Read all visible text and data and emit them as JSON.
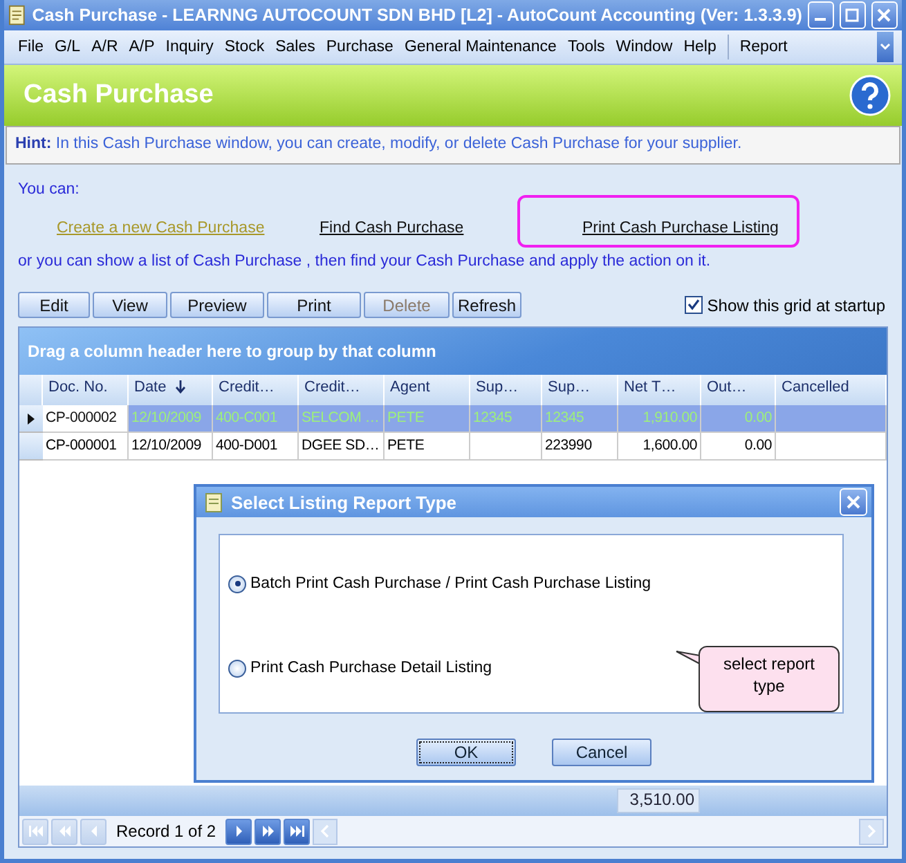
{
  "window": {
    "title": "Cash Purchase - LEARNNG AUTOCOUNT SDN BHD [L2] - AutoCount Accounting (Ver: 1.3.3.9)"
  },
  "menu": [
    "File",
    "G/L",
    "A/R",
    "A/P",
    "Inquiry",
    "Stock",
    "Sales",
    "Purchase",
    "General Maintenance",
    "Tools",
    "Window",
    "Help",
    "Report"
  ],
  "header": {
    "title": "Cash Purchase"
  },
  "hint": "**Hint:** In this Cash Purchase window, you can create, modify, or delete Cash Purchase for your supplier.",
  "intro": "You can:",
  "links": [
    {
      "label": "Create a new Cash Purchase",
      "visited": true
    },
    {
      "label": "Find Cash Purchase",
      "visited": false
    },
    {
      "label": "Print Cash Purchase Listing",
      "visited": false
    }
  ],
  "or_text": "or you can show a  list of Cash Purchase , then find your Cash Purchase and apply the action on it.",
  "toolbar": [
    {
      "label": "Edit",
      "disabled": false
    },
    {
      "label": "View",
      "disabled": false
    },
    {
      "label": "Preview",
      "disabled": false
    },
    {
      "label": "Print",
      "disabled": false
    },
    {
      "label": "Delete",
      "disabled": true
    },
    {
      "label": "Refresh",
      "disabled": false
    }
  ],
  "show_grid": {
    "label": "Show this grid at startup",
    "checked": true
  },
  "grid": {
    "group_hint": "Drag a column header here to group by that column",
    "columns": [
      {
        "label": "Doc. No.",
        "kind": "text"
      },
      {
        "label": "Date",
        "kind": "text",
        "sorted": true
      },
      {
        "label": "Credit…",
        "kind": "text"
      },
      {
        "label": "Credit…",
        "kind": "text"
      },
      {
        "label": "Agent",
        "kind": "text"
      },
      {
        "label": "Sup…",
        "kind": "text"
      },
      {
        "label": "Sup…",
        "kind": "text"
      },
      {
        "label": "Net T…",
        "kind": "number"
      },
      {
        "label": "Out…",
        "kind": "number"
      },
      {
        "label": "Cancelled",
        "kind": "text"
      }
    ],
    "rows": [
      {
        "selected": true,
        "cells": [
          "CP-000002",
          "12/10/2009",
          "400-C001",
          "SELCOM …",
          "PETE",
          "12345",
          "12345",
          "1,910.00",
          "0.00",
          ""
        ]
      },
      {
        "selected": false,
        "cells": [
          "CP-000001",
          "12/10/2009",
          "400-D001",
          "DGEE SD…",
          "PETE",
          "",
          "223990",
          "1,600.00",
          "0.00",
          ""
        ]
      }
    ],
    "total": "3,510.00",
    "record": "Record 1 of 2",
    "nav": [
      {
        "kind": "first",
        "disabled": true
      },
      {
        "kind": "prev_page",
        "disabled": true
      },
      {
        "kind": "prev",
        "disabled": true
      },
      {
        "kind": "next",
        "disabled": false
      },
      {
        "kind": "next_page",
        "disabled": false
      },
      {
        "kind": "last",
        "disabled": false
      }
    ]
  },
  "dialog": {
    "title": "Select Listing Report Type",
    "options": [
      {
        "label": "Batch Print Cash Purchase / Print Cash Purchase Listing",
        "selected": true
      },
      {
        "label": "Print Cash Purchase Detail Listing",
        "selected": false
      }
    ],
    "callout": "select report type",
    "buttons": [
      {
        "label": "OK",
        "focused": true
      },
      {
        "label": "Cancel",
        "focused": false
      }
    ]
  }
}
